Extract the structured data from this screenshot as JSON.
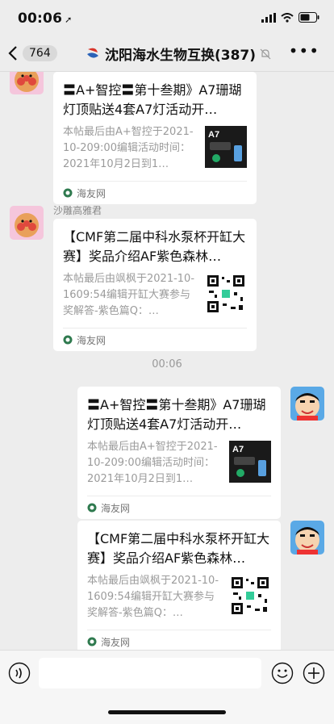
{
  "status": {
    "time": "00:06"
  },
  "nav": {
    "back_count": "764",
    "title": "沈阳海水生物互换(387)"
  },
  "messages": [
    {
      "sender": "",
      "title": "〓A+智控〓第十叁期》A7珊瑚灯顶贴送4套A7灯活动开…",
      "desc": "本帖最后由A+智控于2021-10-209:00编辑活动时间：2021年10月2日到1…",
      "source": "海友网",
      "thumb_label": "A7"
    },
    {
      "sender": "沙雕高雅君",
      "title": "【CMF第二届中科水泵杯开缸大赛】奖品介绍AF紫色森林…",
      "desc": "本帖最后由飒枫于2021-10-1609:54编辑开缸大赛参与奖解答-紫色篇Q：…",
      "source": "海友网"
    },
    {
      "title": "〓A+智控〓第十叁期》A7珊瑚灯顶贴送4套A7灯活动开…",
      "desc": "本帖最后由A+智控于2021-10-209:00编辑活动时间：2021年10月2日到1…",
      "source": "海友网",
      "thumb_label": "A7"
    },
    {
      "title": "【CMF第二届中科水泵杯开缸大赛】奖品介绍AF紫色森林…",
      "desc": "本帖最后由飒枫于2021-10-1609:54编辑开缸大赛参与奖解答-紫色篇Q：…",
      "source": "海友网"
    }
  ],
  "timestamp": "00:06",
  "colors": {
    "background": "#ededed",
    "card": "#ffffff",
    "muted": "#9b9b9b"
  }
}
